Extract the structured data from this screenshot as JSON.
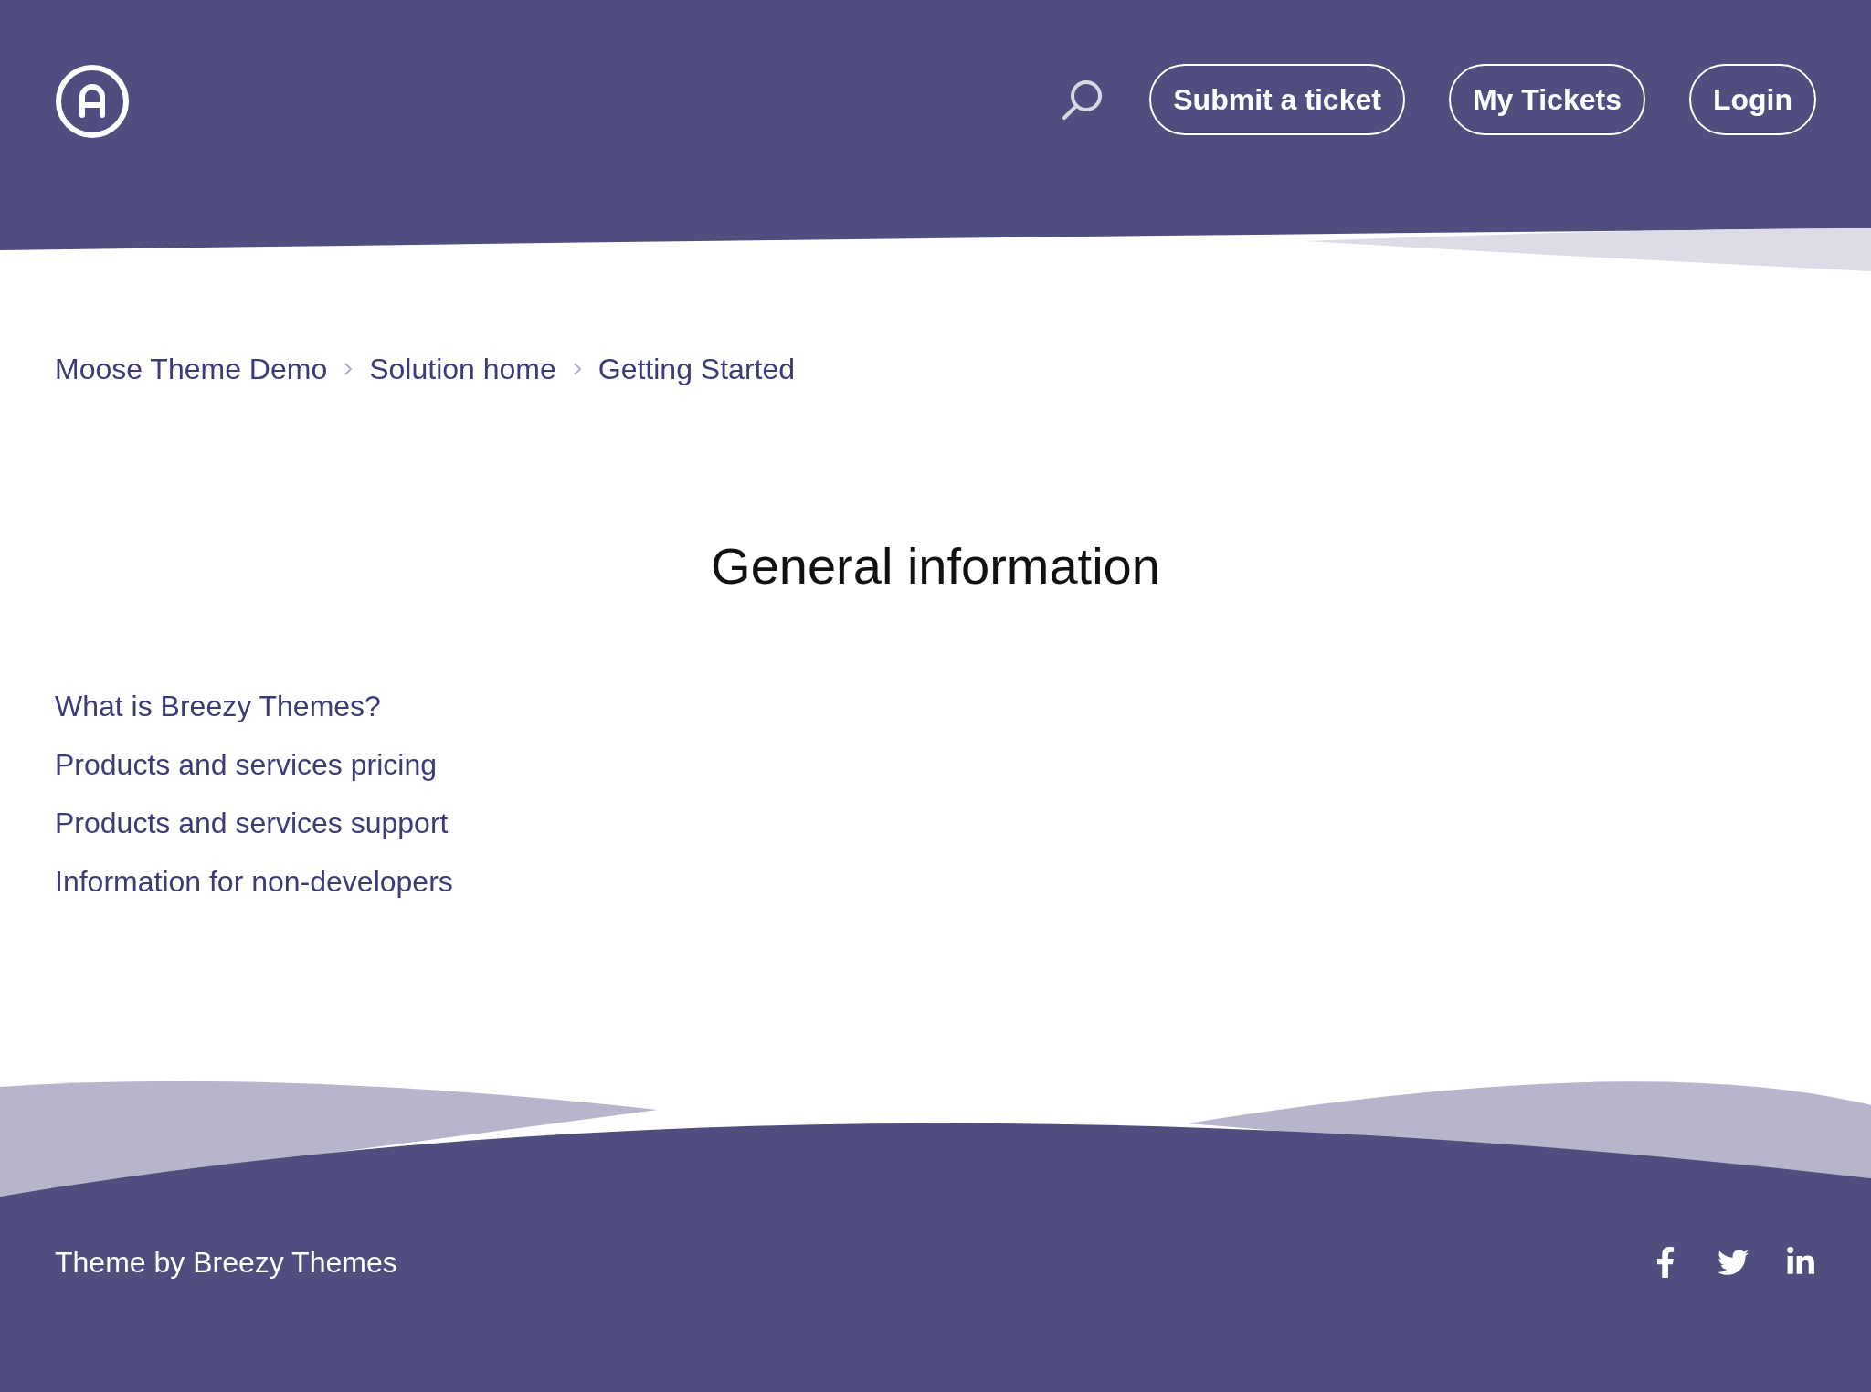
{
  "header": {
    "nav_buttons": [
      "Submit a ticket",
      "My Tickets",
      "Login"
    ]
  },
  "breadcrumb": [
    "Moose Theme Demo",
    "Solution home",
    "Getting Started"
  ],
  "title": "General information",
  "articles": [
    "What is Breezy Themes?",
    "Products and services pricing",
    "Products and services support",
    "Information for non-developers"
  ],
  "footer": {
    "credit": "Theme by Breezy Themes"
  }
}
